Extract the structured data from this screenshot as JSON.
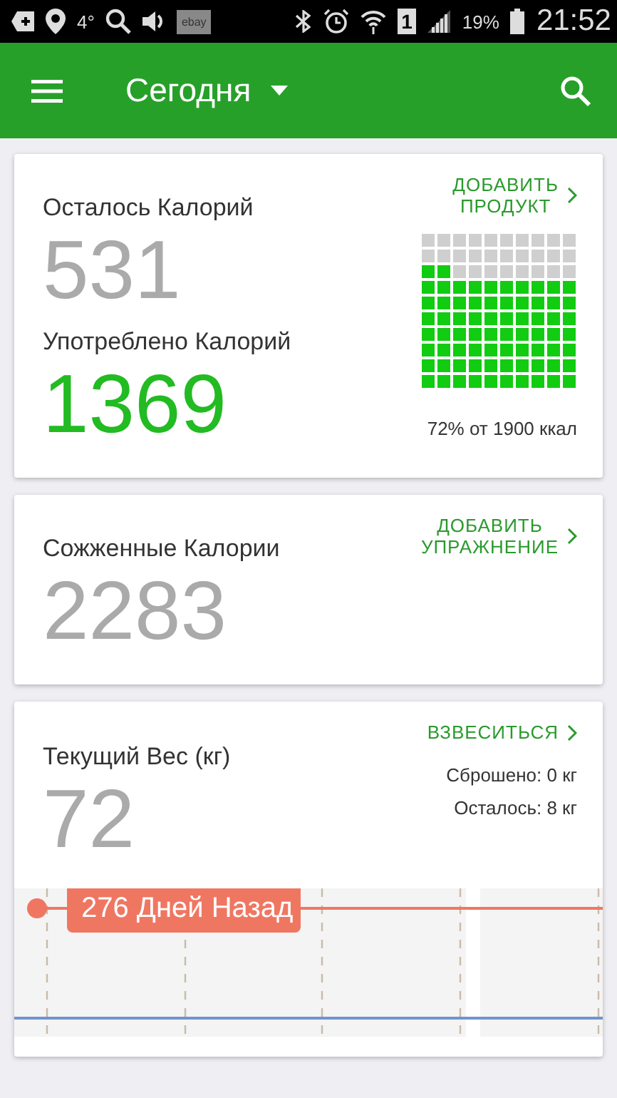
{
  "status_bar": {
    "temperature": "4°",
    "notification_badge": "ebay",
    "sim_slot": "1",
    "battery": "19%",
    "time": "21:52"
  },
  "app_bar": {
    "title": "Сегодня"
  },
  "calories_card": {
    "remaining_label": "Осталось Калорий",
    "remaining_value": "531",
    "consumed_label": "Употреблено Калорий",
    "consumed_value": "1369",
    "action": "ДОБАВИТЬ\nПРОДУКТ",
    "grid": [
      [
        false,
        false,
        false,
        false,
        false,
        false,
        false,
        false,
        false,
        false
      ],
      [
        false,
        false,
        false,
        false,
        false,
        false,
        false,
        false,
        false,
        false
      ],
      [
        true,
        true,
        false,
        false,
        false,
        false,
        false,
        false,
        false,
        false
      ],
      [
        true,
        true,
        true,
        true,
        true,
        true,
        true,
        true,
        true,
        true
      ],
      [
        true,
        true,
        true,
        true,
        true,
        true,
        true,
        true,
        true,
        true
      ],
      [
        true,
        true,
        true,
        true,
        true,
        true,
        true,
        true,
        true,
        true
      ],
      [
        true,
        true,
        true,
        true,
        true,
        true,
        true,
        true,
        true,
        true
      ],
      [
        true,
        true,
        true,
        true,
        true,
        true,
        true,
        true,
        true,
        true
      ],
      [
        true,
        true,
        true,
        true,
        true,
        true,
        true,
        true,
        true,
        true
      ],
      [
        true,
        true,
        true,
        true,
        true,
        true,
        true,
        true,
        true,
        true
      ]
    ],
    "summary": "72% от 1900 ккал"
  },
  "burned_card": {
    "label": "Сожженные Калории",
    "value": "2283",
    "action": "ДОБАВИТЬ\nУПРАЖНЕНИЕ"
  },
  "weight_card": {
    "label": "Текущий Вес (кг)",
    "value": "72",
    "action": "ВЗВЕСИТЬСЯ",
    "lost": "Сброшено: 0 кг",
    "left": "Осталось: 8 кг",
    "chart_callout": "276 Дней Назад"
  }
}
